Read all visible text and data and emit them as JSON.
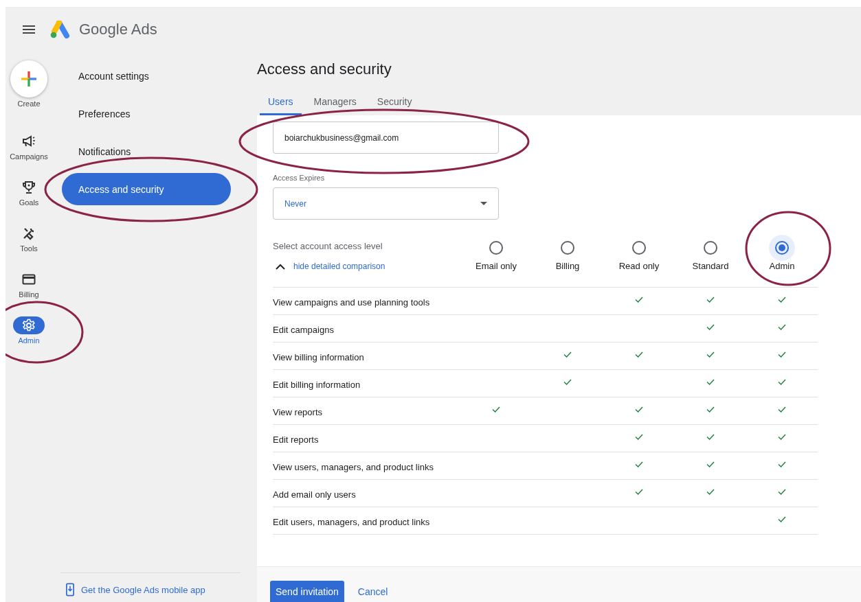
{
  "app": {
    "title": "Google Ads"
  },
  "rail": {
    "create": "Create",
    "items": [
      {
        "label": "Campaigns",
        "selected": false
      },
      {
        "label": "Goals",
        "selected": false
      },
      {
        "label": "Tools",
        "selected": false
      },
      {
        "label": "Billing",
        "selected": false
      },
      {
        "label": "Admin",
        "selected": true
      }
    ]
  },
  "nav": {
    "items": [
      {
        "label": "Account settings",
        "selected": false
      },
      {
        "label": "Preferences",
        "selected": false
      },
      {
        "label": "Notifications",
        "selected": false
      },
      {
        "label": "Access and security",
        "selected": true
      }
    ],
    "mobile_link": "Get the Google Ads mobile app"
  },
  "page": {
    "title": "Access and security",
    "tabs": [
      {
        "label": "Users",
        "selected": true
      },
      {
        "label": "Managers",
        "selected": false
      },
      {
        "label": "Security",
        "selected": false
      }
    ]
  },
  "email_field": {
    "value": "boiarchukbusiness@gmail.com"
  },
  "expires": {
    "label": "Access Expires",
    "value": "Never"
  },
  "access": {
    "label": "Select account access level",
    "toggle": "hide detailed comparison",
    "levels": [
      {
        "label": "Email only",
        "selected": false
      },
      {
        "label": "Billing",
        "selected": false
      },
      {
        "label": "Read only",
        "selected": false
      },
      {
        "label": "Standard",
        "selected": false
      },
      {
        "label": "Admin",
        "selected": true
      }
    ]
  },
  "permissions": [
    {
      "label": "View campaigns and use planning tools",
      "checks": [
        false,
        false,
        true,
        true,
        true
      ]
    },
    {
      "label": "Edit campaigns",
      "checks": [
        false,
        false,
        false,
        true,
        true
      ]
    },
    {
      "label": "View billing information",
      "checks": [
        false,
        true,
        true,
        true,
        true
      ]
    },
    {
      "label": "Edit billing information",
      "checks": [
        false,
        true,
        false,
        true,
        true
      ]
    },
    {
      "label": "View reports",
      "checks": [
        true,
        false,
        true,
        true,
        true
      ]
    },
    {
      "label": "Edit reports",
      "checks": [
        false,
        false,
        true,
        true,
        true
      ]
    },
    {
      "label": "View users, managers, and product links",
      "checks": [
        false,
        false,
        true,
        true,
        true
      ]
    },
    {
      "label": "Add email only users",
      "checks": [
        false,
        false,
        true,
        true,
        true
      ]
    },
    {
      "label": "Edit users, managers, and product links",
      "checks": [
        false,
        false,
        false,
        false,
        true
      ]
    }
  ],
  "footer": {
    "buttons": [
      {
        "label": "Send invitation",
        "kind": "primary"
      },
      {
        "label": "Cancel",
        "kind": "text"
      }
    ]
  }
}
